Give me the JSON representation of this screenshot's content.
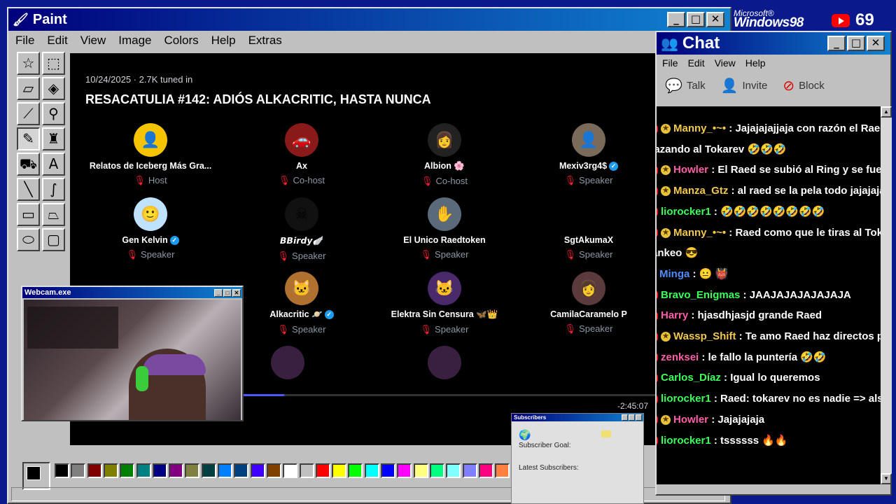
{
  "paint": {
    "title": "Paint",
    "window_buttons": [
      "_",
      "□",
      "✕"
    ],
    "menu": [
      "File",
      "Edit",
      "View",
      "Image",
      "Colors",
      "Help",
      "Extras"
    ]
  },
  "space": {
    "date": "10/24/2025 · 2.7K tuned in",
    "title": "RESACATULIA #142: ADIÓS ALKACRITIC, HASTA NUNCA",
    "duration": "-2:45:07",
    "progress": 0.365,
    "participants": [
      {
        "name": "Relatos de Iceberg Más Gra...",
        "role": "Host",
        "avatar_color": "#f5c400",
        "icon": "man-icon"
      },
      {
        "name": "Ax",
        "role": "Co-host",
        "avatar_color": "#8a1a1a",
        "icon": "car-icon"
      },
      {
        "name": "Albion 🌸",
        "role": "Co-host",
        "avatar_color": "#222222",
        "icon": "woman-icon"
      },
      {
        "name": "Mexiv3rg4$",
        "role": "Speaker",
        "verified": true,
        "avatar_color": "#7a6a5a",
        "icon": "man-icon"
      },
      {
        "name": "Gen Kelvin",
        "role": "Speaker",
        "verified": true,
        "avatar_color": "#bfe3ff",
        "icon": "cartoon-icon"
      },
      {
        "name": "𝘽𝘽𝙞𝙧𝙙𝙮🪽",
        "role": "Speaker",
        "avatar_color": "#111111",
        "icon": "skull-icon"
      },
      {
        "name": "El Unico Raedtoken",
        "role": "Speaker",
        "avatar_color": "#5a6a7a",
        "icon": "hand-icon"
      },
      {
        "name": "SgtAkumaX",
        "role": "Speaker",
        "avatar_color": "#000000",
        "icon": "skull-icon"
      },
      {
        "name": "Alkacritic 🪐",
        "role": "Speaker",
        "verified": true,
        "avatar_color": "#b07030",
        "icon": "cat-icon"
      },
      {
        "name": "Elektra Sin Censura 🦋👑",
        "role": "Speaker",
        "avatar_color": "#4a2a6a",
        "icon": "cat-icon"
      },
      {
        "name": "CamilaCaramelo P",
        "role": "Speaker",
        "avatar_color": "#5a3a3a",
        "icon": "woman-icon"
      }
    ]
  },
  "webcam": {
    "title": "Webcam.exe"
  },
  "subscribers": {
    "title": "Subscribers",
    "goal_label": "Subscriber Goal:",
    "latest_label": "Latest Subscribers:"
  },
  "brand": {
    "ms": "Microsoft®",
    "os": "Windows98"
  },
  "youtube": {
    "count": "69"
  },
  "chat": {
    "title": "Chat",
    "menu": [
      "File",
      "Edit",
      "View",
      "Help"
    ],
    "tools": [
      "Talk",
      "Invite",
      "Block"
    ],
    "messages": [
      {
        "user": "Manny_•~•",
        "color": "#f2c84b",
        "badge": "star",
        "text": ": Jajajajajjaja con razón el Raed"
      },
      {
        "user": "",
        "color": "#ffffff",
        "badge": "none",
        "text": "cazando al Tokarev 🤣🤣🤣"
      },
      {
        "user": "Howler",
        "color": "#ff5fa8",
        "badge": "star",
        "text": ": El Raed se subió al Ring y se fue po"
      },
      {
        "user": "Manza_Gtz",
        "color": "#f2c84b",
        "badge": "star",
        "text": ": al raed se la pela todo jajajajajh"
      },
      {
        "user": "liorocker1",
        "color": "#3bff5a",
        "badge": "yt",
        "text": ": 🤣🤣🤣🤣🤣🤣🤣🤣"
      },
      {
        "user": "Manny_•~•",
        "color": "#f2c84b",
        "badge": "star",
        "text": ": Raed como que le tiras al Tokar"
      },
      {
        "user": "",
        "color": "#ffffff",
        "badge": "none",
        "text": "tankeo 😎"
      },
      {
        "user": "Minga",
        "color": "#4f8cff",
        "badge": "kick",
        "text": ": 😐 👹"
      },
      {
        "user": "Bravo_Enigmas",
        "color": "#3bff5a",
        "badge": "yt",
        "text": ": JAAJAJAJAJAJAJA"
      },
      {
        "user": "Harry",
        "color": "#ff5fa8",
        "badge": "yt",
        "text": ": hjasdhjasjd grande Raed"
      },
      {
        "user": "Wassp_Shift",
        "color": "#f2c84b",
        "badge": "star",
        "text": ": Te amo Raed haz directos por"
      },
      {
        "user": "zenksei",
        "color": "#ff5fa8",
        "badge": "yt",
        "text": ": le fallo la puntería 🤣🤣"
      },
      {
        "user": "Carlos_Díaz",
        "color": "#3bff5a",
        "badge": "yt",
        "text": ": Igual lo queremos"
      },
      {
        "user": "liorocker1",
        "color": "#3bff5a",
        "badge": "yt",
        "text": ": Raed: tokarev no es nadie => also"
      },
      {
        "user": "Howler",
        "color": "#ff5fa8",
        "badge": "star",
        "text": ": Jajajajaja"
      },
      {
        "user": "liorocker1",
        "color": "#3bff5a",
        "badge": "yt",
        "text": ": tssssss 🔥🔥"
      }
    ]
  },
  "palette": {
    "colors": [
      "#000000",
      "#808080",
      "#800000",
      "#808000",
      "#008000",
      "#008080",
      "#000080",
      "#800080",
      "#808040",
      "#004040",
      "#0080ff",
      "#004080",
      "#4000ff",
      "#804000",
      "#ffffff",
      "#c0c0c0",
      "#ff0000",
      "#ffff00",
      "#00ff00",
      "#00ffff",
      "#0000ff",
      "#ff00ff",
      "#ffff80",
      "#00ff80",
      "#80ffff",
      "#8080ff",
      "#ff0080",
      "#ff8040"
    ]
  }
}
